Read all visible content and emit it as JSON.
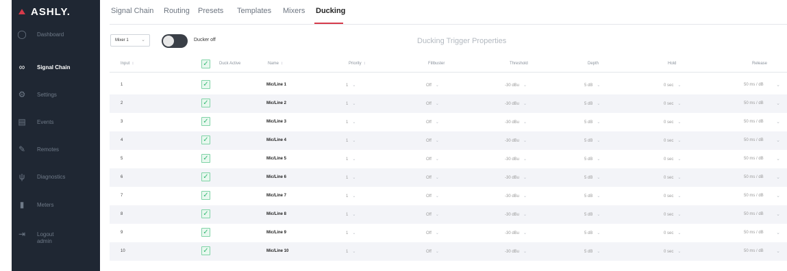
{
  "app": {
    "logo_text": "ASHLY."
  },
  "sidebar": {
    "items": [
      {
        "label": "Dashboard",
        "icon": "dashboard-icon",
        "active": false
      },
      {
        "label": "Signal Chain",
        "icon": "signal-chain-icon",
        "active": true
      },
      {
        "label": "Settings",
        "icon": "gear-icon",
        "active": false
      },
      {
        "label": "Events",
        "icon": "calendar-icon",
        "active": false
      },
      {
        "label": "Remotes",
        "icon": "remote-icon",
        "active": false
      },
      {
        "label": "Diagnostics",
        "icon": "stethoscope-icon",
        "active": false
      },
      {
        "label": "Meters",
        "icon": "meters-icon",
        "active": false
      },
      {
        "label": "Logout",
        "sub": "admin",
        "icon": "logout-icon",
        "active": false
      }
    ]
  },
  "tabs": [
    {
      "label": "Signal Chain",
      "active": false
    },
    {
      "label": "Routing",
      "active": false
    },
    {
      "label": "Presets",
      "active": false
    },
    {
      "label": "Templates",
      "active": false
    },
    {
      "label": "Mixers",
      "active": false
    },
    {
      "label": "Ducking",
      "active": true
    }
  ],
  "toolbar": {
    "mixer_select": "Mixer 1",
    "ducker_toggle_label": "Ducker off",
    "ducker_on": false,
    "panel_title": "Ducking Trigger Properties"
  },
  "table": {
    "headers": {
      "input": "Input",
      "duck_active": "Duck Active",
      "name": "Name",
      "priority": "Priority",
      "fillbuster": "Fillbuster",
      "threshold": "Threshold",
      "depth": "Depth",
      "hold": "Hold",
      "release": "Release"
    },
    "rows": [
      {
        "input": "1",
        "name": "Mic/Line 1",
        "priority": "1",
        "fillbuster": "Off",
        "threshold": "-30 dBu",
        "depth": "5 dB",
        "hold": "0 sec",
        "release": "50 ms / dB"
      },
      {
        "input": "2",
        "name": "Mic/Line 2",
        "priority": "1",
        "fillbuster": "Off",
        "threshold": "-30 dBu",
        "depth": "5 dB",
        "hold": "0 sec",
        "release": "50 ms / dB"
      },
      {
        "input": "3",
        "name": "Mic/Line 3",
        "priority": "1",
        "fillbuster": "Off",
        "threshold": "-30 dBu",
        "depth": "5 dB",
        "hold": "0 sec",
        "release": "50 ms / dB"
      },
      {
        "input": "4",
        "name": "Mic/Line 4",
        "priority": "1",
        "fillbuster": "Off",
        "threshold": "-30 dBu",
        "depth": "5 dB",
        "hold": "0 sec",
        "release": "50 ms / dB"
      },
      {
        "input": "5",
        "name": "Mic/Line 5",
        "priority": "1",
        "fillbuster": "Off",
        "threshold": "-30 dBu",
        "depth": "5 dB",
        "hold": "0 sec",
        "release": "50 ms / dB"
      },
      {
        "input": "6",
        "name": "Mic/Line 6",
        "priority": "1",
        "fillbuster": "Off",
        "threshold": "-30 dBu",
        "depth": "5 dB",
        "hold": "0 sec",
        "release": "50 ms / dB"
      },
      {
        "input": "7",
        "name": "Mic/Line 7",
        "priority": "1",
        "fillbuster": "Off",
        "threshold": "-30 dBu",
        "depth": "5 dB",
        "hold": "0 sec",
        "release": "50 ms / dB"
      },
      {
        "input": "8",
        "name": "Mic/Line 8",
        "priority": "1",
        "fillbuster": "Off",
        "threshold": "-30 dBu",
        "depth": "5 dB",
        "hold": "0 sec",
        "release": "50 ms / dB"
      },
      {
        "input": "9",
        "name": "Mic/Line 9",
        "priority": "1",
        "fillbuster": "Off",
        "threshold": "-30 dBu",
        "depth": "5 dB",
        "hold": "0 sec",
        "release": "50 ms / dB"
      },
      {
        "input": "10",
        "name": "Mic/Line 10",
        "priority": "1",
        "fillbuster": "Off",
        "threshold": "-30 dBu",
        "depth": "5 dB",
        "hold": "0 sec",
        "release": "50 ms / dB"
      }
    ]
  },
  "colors": {
    "accent": "#d63a4a",
    "sidebar_bg": "#1f2733",
    "check": "#35b873",
    "row_alt": "#f3f4f8"
  }
}
